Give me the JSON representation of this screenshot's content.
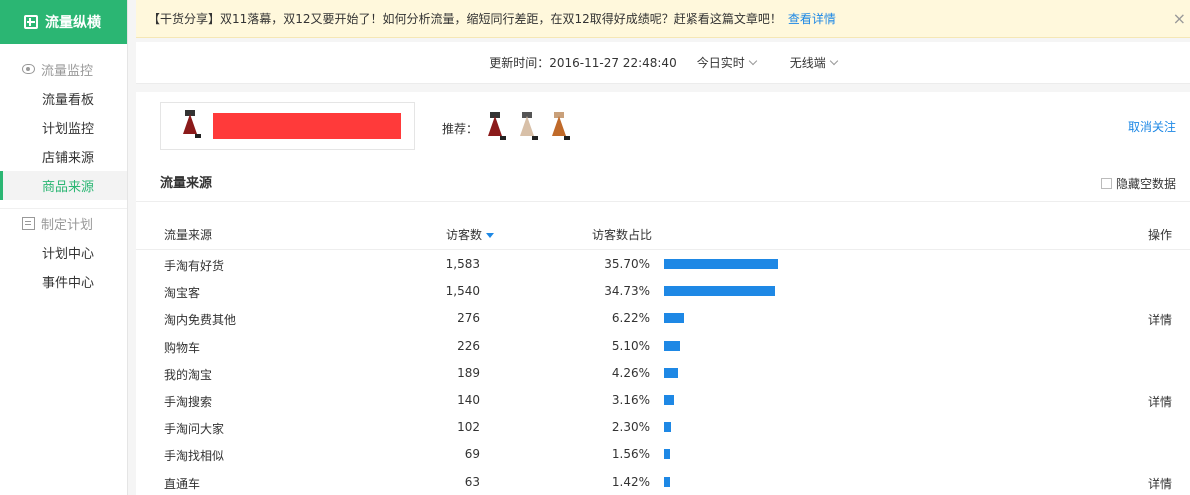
{
  "sidebar": {
    "brand": "流量纵横",
    "section1": "流量监控",
    "items1": [
      "流量看板",
      "计划监控",
      "店铺来源",
      "商品来源"
    ],
    "section2": "制定计划",
    "items2": [
      "计划中心",
      "事件中心"
    ]
  },
  "notice": {
    "text": "【干货分享】双11落幕，双12又要开始了！如何分析流量，缩短同行差距，在双12取得好成绩呢？赶紧看这篇文章吧！",
    "link": "查看详情",
    "close": "×"
  },
  "update_bar": {
    "time_label": "更新时间：2016-11-27 22:48:40",
    "period": "今日实时",
    "device": "无线端"
  },
  "product": {
    "recommend_label": "推荐：",
    "unfollow": "取消关注"
  },
  "traffic": {
    "title": "流量来源",
    "hide_empty": "隐藏空数据",
    "headers": {
      "source": "流量来源",
      "visitors": "访客数",
      "share": "访客数占比",
      "action": "操作"
    },
    "rows": [
      {
        "name": "手淘有好货",
        "visitors": "1,583",
        "share": "35.70%",
        "ratio": 35.7,
        "action": ""
      },
      {
        "name": "淘宝客",
        "visitors": "1,540",
        "share": "34.73%",
        "ratio": 34.73,
        "action": ""
      },
      {
        "name": "淘内免费其他",
        "visitors": "276",
        "share": "6.22%",
        "ratio": 6.22,
        "action": "详情"
      },
      {
        "name": "购物车",
        "visitors": "226",
        "share": "5.10%",
        "ratio": 5.1,
        "action": ""
      },
      {
        "name": "我的淘宝",
        "visitors": "189",
        "share": "4.26%",
        "ratio": 4.26,
        "action": ""
      },
      {
        "name": "手淘搜索",
        "visitors": "140",
        "share": "3.16%",
        "ratio": 3.16,
        "action": "详情"
      },
      {
        "name": "手淘问大家",
        "visitors": "102",
        "share": "2.30%",
        "ratio": 2.3,
        "action": ""
      },
      {
        "name": "手淘找相似",
        "visitors": "69",
        "share": "1.56%",
        "ratio": 1.56,
        "action": ""
      },
      {
        "name": "直通车",
        "visitors": "63",
        "share": "1.42%",
        "ratio": 1.42,
        "action": "详情"
      }
    ]
  },
  "colors": {
    "brand": "#2bb673",
    "link": "#1e88e5",
    "bar": "#1e88e5",
    "notice_bg": "#fff8dc"
  }
}
